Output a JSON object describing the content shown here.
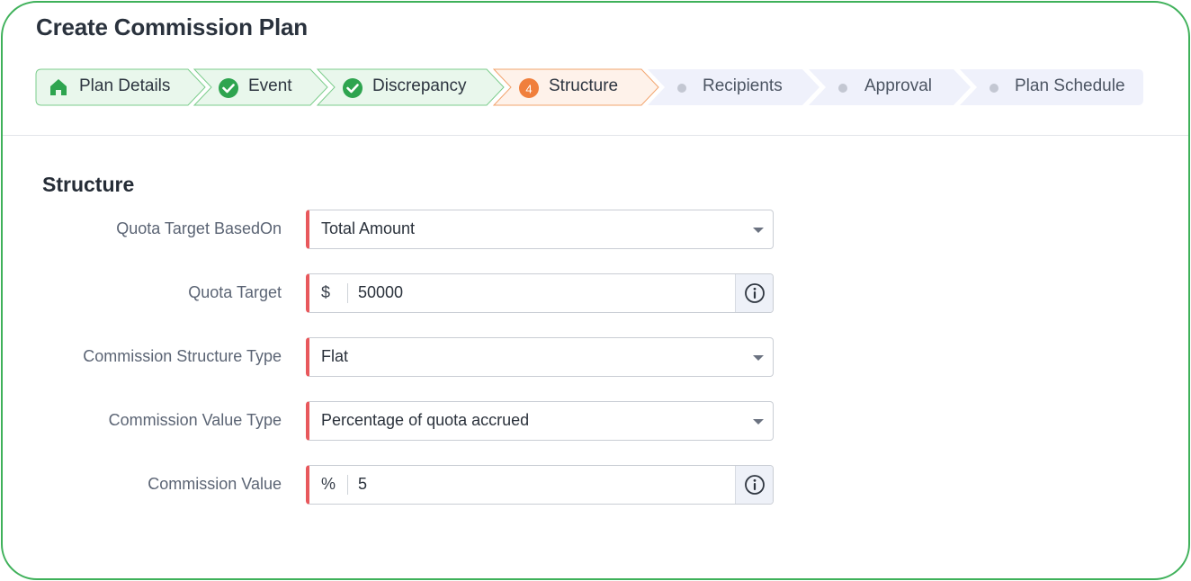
{
  "page": {
    "title": "Create Commission Plan"
  },
  "stepper": {
    "steps": [
      {
        "label": "Plan Details",
        "state": "done",
        "icon": "home-icon"
      },
      {
        "label": "Event",
        "state": "done",
        "icon": "check-circle-icon"
      },
      {
        "label": "Discrepancy",
        "state": "done",
        "icon": "check-circle-icon"
      },
      {
        "label": "Structure",
        "state": "current",
        "number": "4"
      },
      {
        "label": "Recipients",
        "state": "todo",
        "icon": "dot-icon"
      },
      {
        "label": "Approval",
        "state": "todo",
        "icon": "dot-icon"
      },
      {
        "label": "Plan Schedule",
        "state": "todo",
        "icon": "dot-icon"
      }
    ]
  },
  "section": {
    "title": "Structure"
  },
  "form": {
    "quota_target_based_on": {
      "label": "Quota Target BasedOn",
      "value": "Total Amount"
    },
    "quota_target": {
      "label": "Quota Target",
      "prefix": "$",
      "value": "50000"
    },
    "commission_structure_type": {
      "label": "Commission Structure Type",
      "value": "Flat"
    },
    "commission_value_type": {
      "label": "Commission Value Type",
      "value": "Percentage of quota accrued"
    },
    "commission_value": {
      "label": "Commission Value",
      "prefix": "%",
      "value": "5"
    }
  },
  "colors": {
    "frame_border": "#3fb15a",
    "done_fill": "#e9f7ec",
    "done_stroke": "#7ccd8c",
    "done_icon": "#2ea44f",
    "current_fill": "#fef2ea",
    "current_stroke": "#f2a46e",
    "current_badge": "#f07f3c",
    "todo_fill": "#eff1fb",
    "required_marker": "#e8585c"
  }
}
